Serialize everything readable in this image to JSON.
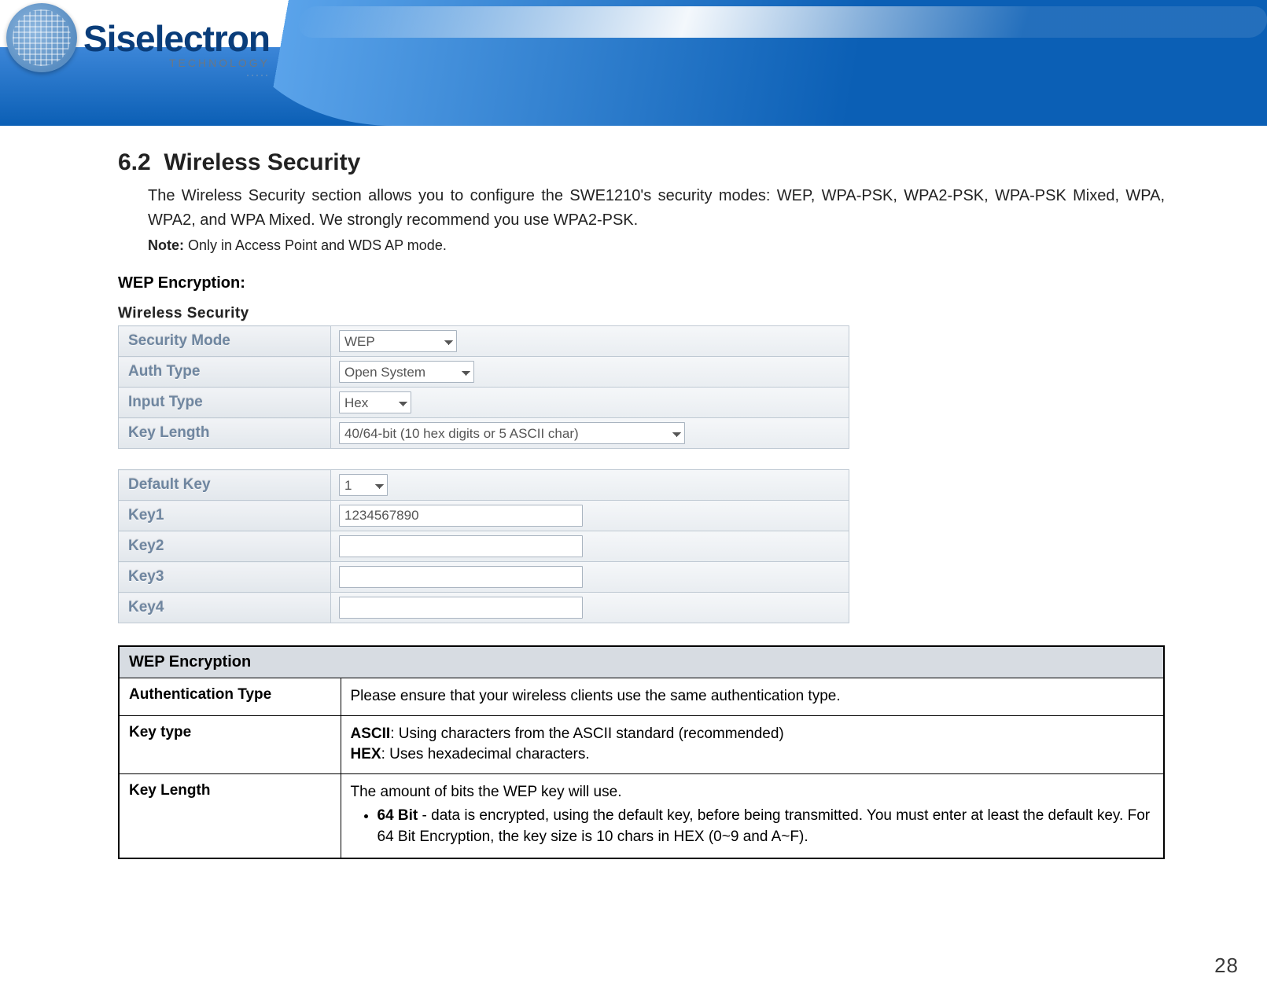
{
  "brand": {
    "name": "Siselectron",
    "sub": "TECHNOLOGY",
    "dots": "·····"
  },
  "section": {
    "number": "6.2",
    "title": "Wireless Security",
    "intro": "The Wireless Security section allows you to configure the SWE1210's security modes: WEP, WPA-PSK, WPA2-PSK, WPA-PSK Mixed, WPA, WPA2, and WPA Mixed. We strongly recommend you use WPA2-PSK.",
    "note_label": "Note:",
    "note_text": " Only in Access Point and WDS AP mode.",
    "wep_label": "WEP Encryption:"
  },
  "form": {
    "panel_title": "Wireless Security",
    "rows": {
      "security_mode": {
        "label": "Security Mode",
        "value": "WEP"
      },
      "auth_type": {
        "label": "Auth Type",
        "value": "Open System"
      },
      "input_type": {
        "label": "Input Type",
        "value": "Hex"
      },
      "key_length": {
        "label": "Key Length",
        "value": "40/64-bit (10 hex digits or 5 ASCII char)"
      },
      "default_key": {
        "label": "Default Key",
        "value": "1"
      },
      "key1": {
        "label": "Key1",
        "value": "1234567890"
      },
      "key2": {
        "label": "Key2",
        "value": ""
      },
      "key3": {
        "label": "Key3",
        "value": ""
      },
      "key4": {
        "label": "Key4",
        "value": ""
      }
    }
  },
  "desc": {
    "header": "WEP Encryption",
    "auth": {
      "label": "Authentication Type",
      "text": "Please ensure that your wireless clients use the same authentication type."
    },
    "keytype": {
      "label": "Key type",
      "ascii_b": "ASCII",
      "ascii_t": ": Using characters from the ASCII standard (recommended)",
      "hex_b": "HEX",
      "hex_t": ": Uses hexadecimal characters."
    },
    "keylen": {
      "label": "Key Length",
      "intro": "The amount of bits the WEP key will use.",
      "b64_b": "64 Bit",
      "b64_t": " - data is encrypted, using the default key, before being transmitted. You must enter at least the default key. For 64 Bit Encryption, the key size is 10 chars in HEX (0~9 and A~F)."
    }
  },
  "page_number": "28"
}
